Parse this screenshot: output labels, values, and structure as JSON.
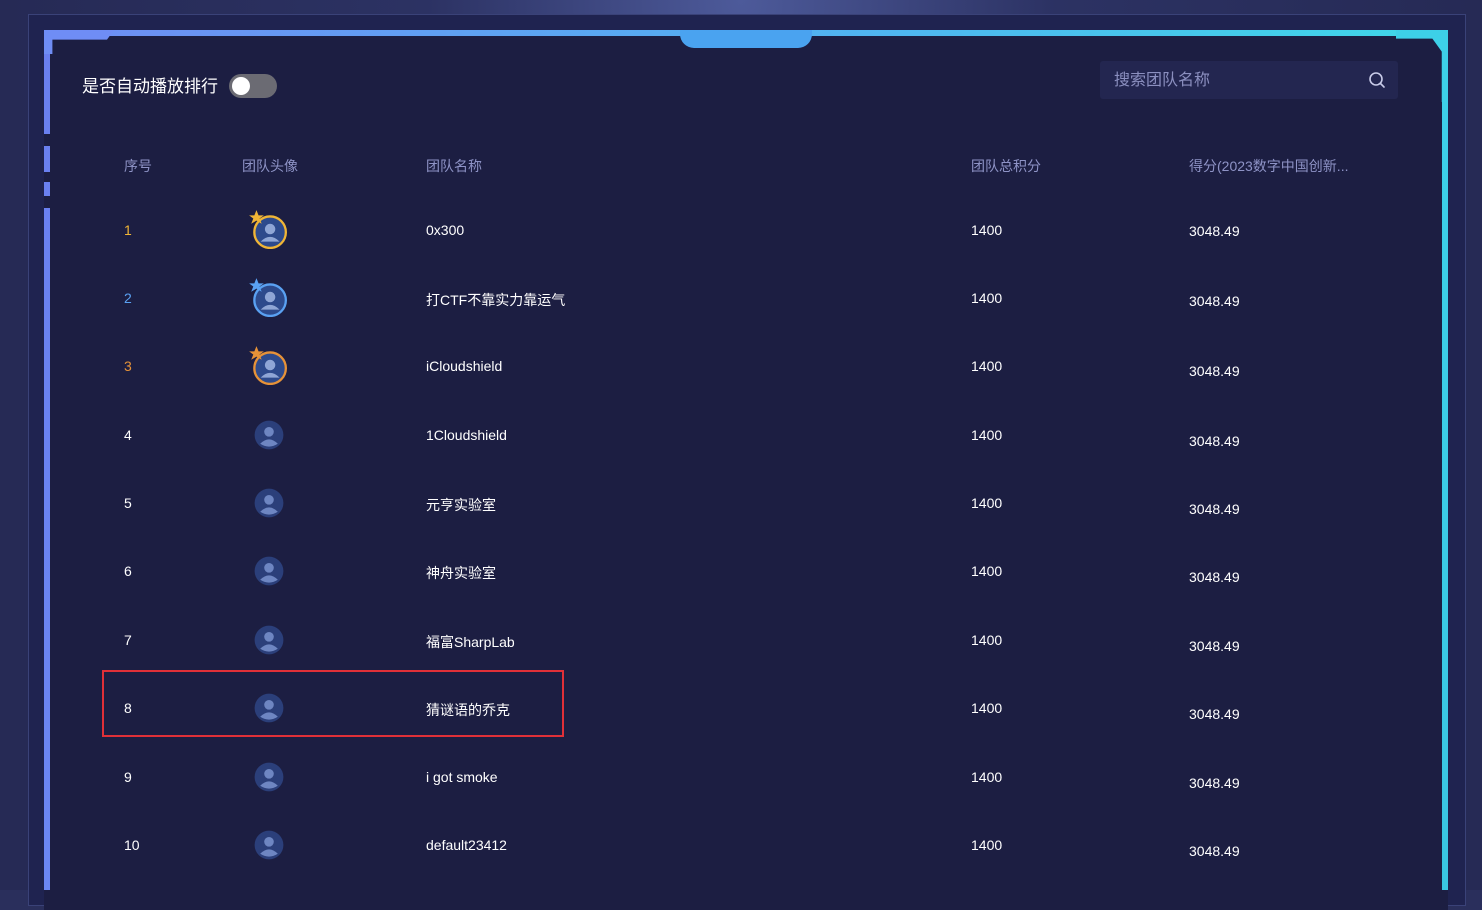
{
  "autoplay": {
    "label": "是否自动播放排行",
    "enabled": false
  },
  "search": {
    "placeholder": "搜索团队名称",
    "value": ""
  },
  "table": {
    "headers": {
      "rank": "序号",
      "avatar": "团队头像",
      "name": "团队名称",
      "total": "团队总积分",
      "score": "得分(2023数字中国创新..."
    },
    "rows": [
      {
        "rank": "1",
        "name": "0x300",
        "total": "1400",
        "score": "3048.49",
        "medal": "gold"
      },
      {
        "rank": "2",
        "name": "打CTF不靠实力靠运气",
        "total": "1400",
        "score": "3048.49",
        "medal": "silver"
      },
      {
        "rank": "3",
        "name": "iCloudshield",
        "total": "1400",
        "score": "3048.49",
        "medal": "bronze"
      },
      {
        "rank": "4",
        "name": "1Cloudshield",
        "total": "1400",
        "score": "3048.49",
        "medal": "none"
      },
      {
        "rank": "5",
        "name": "元亨实验室",
        "total": "1400",
        "score": "3048.49",
        "medal": "none"
      },
      {
        "rank": "6",
        "name": "神舟实验室",
        "total": "1400",
        "score": "3048.49",
        "medal": "none"
      },
      {
        "rank": "7",
        "name": "福富SharpLab",
        "total": "1400",
        "score": "3048.49",
        "medal": "none"
      },
      {
        "rank": "8",
        "name": "猜谜语的乔克",
        "total": "1400",
        "score": "3048.49",
        "medal": "none"
      },
      {
        "rank": "9",
        "name": "i got smoke",
        "total": "1400",
        "score": "3048.49",
        "medal": "none"
      },
      {
        "rank": "10",
        "name": "default23412",
        "total": "1400",
        "score": "3048.49",
        "medal": "none"
      }
    ]
  },
  "colors": {
    "background": "#1c1e42",
    "header_text": "#8e93c6",
    "gold": "#f0b536",
    "silver": "#5aa1f2",
    "bronze": "#e69238",
    "highlight_border": "#e03038"
  }
}
